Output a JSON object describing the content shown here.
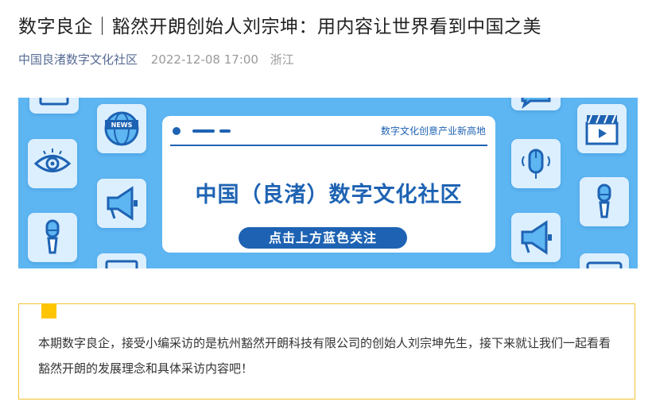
{
  "article": {
    "title": "数字良企｜豁然开朗创始人刘宗坤：用内容让世界看到中国之美",
    "author": "中国良渚数字文化社区",
    "date": "2022-12-08 17:00",
    "location": "浙江"
  },
  "banner": {
    "slogan": "数字文化创意产业新高地",
    "headline": "中国（良渚）数字文化社区",
    "follow_label": "点击上方蓝色关注",
    "news_badge": "NEWS",
    "colors": {
      "background": "#5db5f1",
      "tile": "#dcefff",
      "accent": "#1e63b3"
    },
    "icons": [
      "monitor-icon",
      "globe-news-icon",
      "eye-icon",
      "megaphone-icon",
      "microphone-icon",
      "chat-bubble-icon",
      "clapperboard-icon",
      "mouse-icon",
      "microphone-icon",
      "megaphone-icon",
      "document-icon"
    ]
  },
  "intro": {
    "text": "本期数字良企，接受小编采访的是杭州豁然开朗科技有限公司的创始人刘宗坤先生，接下来就让我们一起看看豁然开朗的发展理念和具体采访内容吧！"
  }
}
